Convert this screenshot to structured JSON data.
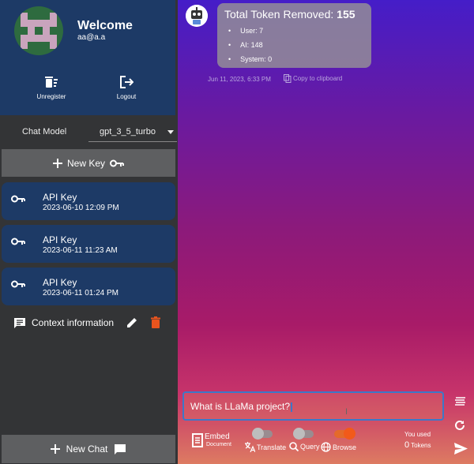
{
  "profile": {
    "welcome": "Welcome",
    "email": "aa@a.a",
    "unregister_label": "Unregister",
    "logout_label": "Logout"
  },
  "model": {
    "label": "Chat Model",
    "selected": "gpt_3_5_turbo"
  },
  "new_key_label": "New Key",
  "api_keys": [
    {
      "title": "API Key",
      "date": "2023-06-10 12:09 PM"
    },
    {
      "title": "API Key",
      "date": "2023-06-11 11:23 AM"
    },
    {
      "title": "API Key",
      "date": "2023-06-11 01:24 PM"
    }
  ],
  "context": {
    "label": "Context information"
  },
  "new_chat_label": "New Chat",
  "message": {
    "title_prefix": "Total Token Removed:",
    "title_value": "155",
    "items": [
      "User: 7",
      "AI: 148",
      "System: 0"
    ],
    "time": "Jun 11, 2023, 6:33 PM",
    "copy_label": "Copy to clipboard"
  },
  "input": {
    "value": "What is LLaMa project?"
  },
  "toolbar": {
    "embed_label": "Embed",
    "embed_sub": "Document",
    "translate_label": "Translate",
    "query_label": "Query",
    "browse_label": "Browse",
    "translate_on": false,
    "query_on": false,
    "browse_on": true
  },
  "usage": {
    "label": "You used",
    "count": "0",
    "unit": "Tokens"
  },
  "colors": {
    "sidebar": "#333436",
    "panel_blue": "#1d3a66",
    "button_gray": "#5e5f61",
    "delete_orange": "#e8541e",
    "accent_blue": "#3c78c8"
  }
}
